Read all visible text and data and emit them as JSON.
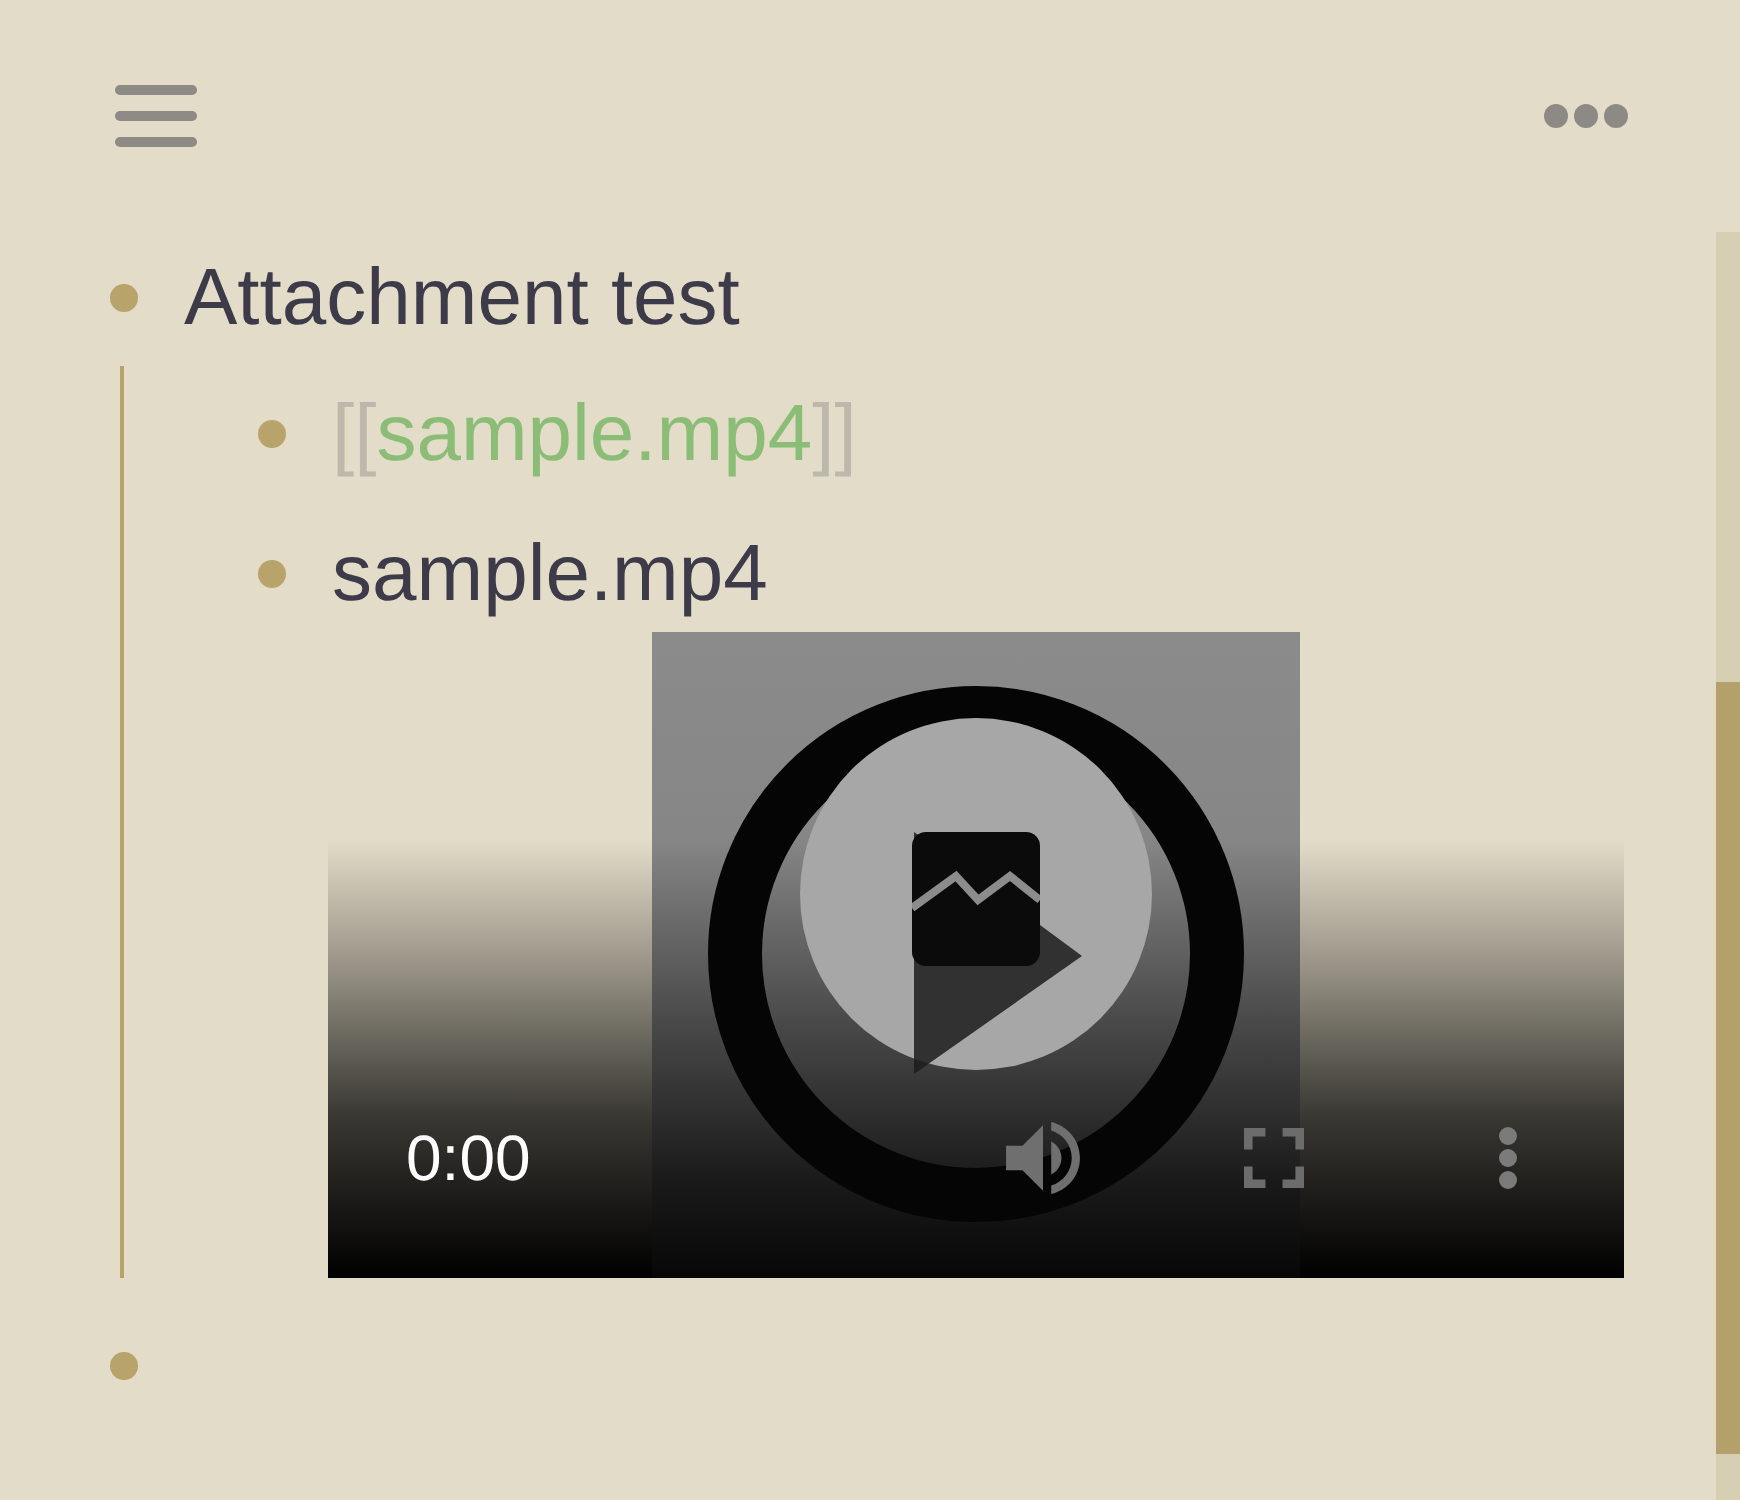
{
  "outline": [
    {
      "kind": "text",
      "text": "Attachment test",
      "children": [
        {
          "kind": "link",
          "open": "[[",
          "target": "sample.mp4",
          "close": "]]"
        },
        {
          "kind": "embed",
          "text": "sample.mp4",
          "video": {
            "time": "0:00"
          }
        }
      ]
    },
    {
      "kind": "empty"
    }
  ]
}
